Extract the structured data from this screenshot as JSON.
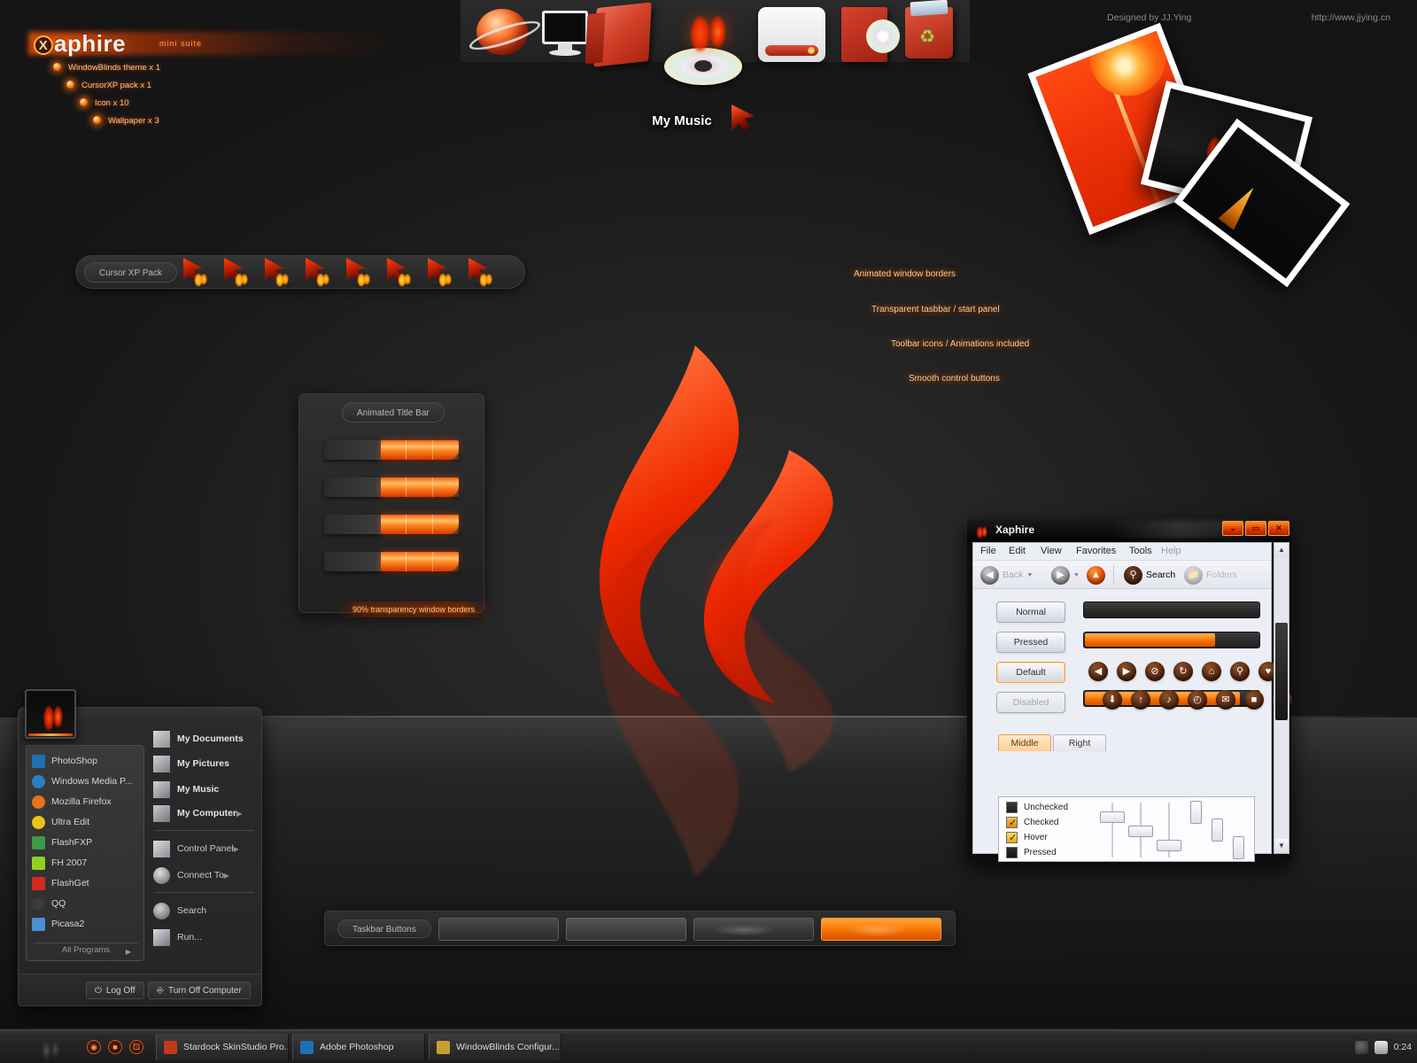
{
  "brand": {
    "name_x": "X",
    "name": "aphire",
    "subtitle": "mini suite",
    "items": [
      {
        "label": "WindowBlinds theme x 1"
      },
      {
        "label": "CursorXP pack x 1"
      },
      {
        "label": "Icon x 10"
      },
      {
        "label": "Wallpaper x 3"
      }
    ]
  },
  "credits": {
    "designer": "Designed by JJ.Ying",
    "url": "http://www.jjying.cn"
  },
  "desktop_icons": {
    "selected_label": "My Music",
    "icons": [
      {
        "name": "network-globe-icon"
      },
      {
        "name": "monitor-icon"
      },
      {
        "name": "folder-icon"
      },
      {
        "name": "cd-flame-icon"
      },
      {
        "name": "hard-drive-icon"
      },
      {
        "name": "cd-case-icon"
      },
      {
        "name": "recycle-bin-icon"
      }
    ]
  },
  "cursor_panel": {
    "label": "Cursor XP Pack",
    "count": 8
  },
  "titlebar_panel": {
    "label": "Animated Title Bar",
    "caption": "90% transparency window borders",
    "samples": 4
  },
  "callouts": [
    {
      "label": "Animated window borders"
    },
    {
      "label": "Transparent tasbbar / start panel"
    },
    {
      "label": "Toolbar icons / Animations included"
    },
    {
      "label": "Smooth control buttons"
    }
  ],
  "taskbar_buttons_panel": {
    "label": "Taskbar Buttons",
    "states": [
      "normal",
      "hover",
      "flare",
      "active"
    ]
  },
  "xaphire_window": {
    "title": "Xaphire",
    "window_controls": [
      {
        "name": "minimize-button",
        "glyph": "⌄"
      },
      {
        "name": "maximize-button",
        "glyph": "▭"
      },
      {
        "name": "close-button",
        "glyph": "✕"
      }
    ],
    "menu": [
      {
        "label": "File",
        "mnemonic": "F",
        "rest": "ile",
        "dim": false
      },
      {
        "label": "Edit",
        "mnemonic": "E",
        "rest": "dit",
        "dim": false
      },
      {
        "label": "View",
        "mnemonic": "V",
        "rest": "iew",
        "dim": false
      },
      {
        "label": "Favorites",
        "mnemonic": "F",
        "rest": "avorites",
        "dim": false
      },
      {
        "label": "Tools",
        "mnemonic": "T",
        "rest": "ools",
        "dim": false
      },
      {
        "label": "Help",
        "mnemonic": "H",
        "rest": "elp",
        "dim": true
      }
    ],
    "toolbar": {
      "back": "Back",
      "forward": "",
      "up": "",
      "search": "Search",
      "folders": "Folders"
    },
    "state_buttons": [
      {
        "label": "Normal",
        "state": "normal"
      },
      {
        "label": "Pressed",
        "state": "pressed"
      },
      {
        "label": "Default",
        "state": "default"
      },
      {
        "label": "Disabled",
        "state": "disabled"
      }
    ],
    "progress_bars": [
      {
        "name": "empty-progress",
        "percent": 0
      },
      {
        "name": "filled-progress",
        "percent": 74
      },
      {
        "name": "nearly-full-progress",
        "percent": 88
      }
    ],
    "toolbar_icon_glyphs_row1": [
      "◀",
      "▶",
      "⊘",
      "↻",
      "⌂",
      "⚲",
      "♥"
    ],
    "toolbar_icon_glyphs_row2": [
      "⬇",
      "↑",
      "♪",
      "◴",
      "✉",
      "■",
      "▬"
    ],
    "tabs": [
      {
        "label": "Middle",
        "active": true
      },
      {
        "label": "Right",
        "active": false
      }
    ],
    "checkbox_states": [
      {
        "label": "Unchecked",
        "state": "unchecked"
      },
      {
        "label": "Checked",
        "state": "checked"
      },
      {
        "label": "Hover",
        "state": "hover"
      },
      {
        "label": "Pressed",
        "state": "pressed"
      }
    ]
  },
  "start_menu": {
    "programs": [
      {
        "label": "PhotoShop",
        "color": "#1f6fb5"
      },
      {
        "label": "Windows Media P...",
        "color": "#2a7fc0"
      },
      {
        "label": "Mozilla Firefox",
        "color": "#e8731a"
      },
      {
        "label": "Ultra Edit",
        "color": "#e8c418"
      },
      {
        "label": "FlashFXP",
        "color": "#3c9a4a"
      },
      {
        "label": "FH 2007",
        "color": "#8fd020"
      },
      {
        "label": "FlashGet",
        "color": "#d42a1e"
      },
      {
        "label": "QQ",
        "color": "#3a3a3a"
      },
      {
        "label": "Picasa2",
        "color": "#4b8fd0"
      }
    ],
    "all_programs": "All Programs",
    "places": [
      {
        "label": "My Documents",
        "bold": true,
        "arrow": false,
        "icon": "documents-icon"
      },
      {
        "label": "My Pictures",
        "bold": true,
        "arrow": false,
        "icon": "pictures-icon"
      },
      {
        "label": "My Music",
        "bold": true,
        "arrow": false,
        "icon": "music-icon"
      },
      {
        "label": "My Computer",
        "bold": true,
        "arrow": true,
        "icon": "computer-icon"
      },
      {
        "label": "Control Panel",
        "bold": false,
        "arrow": true,
        "icon": "control-panel-icon"
      },
      {
        "label": "Connect To",
        "bold": false,
        "arrow": true,
        "icon": "connect-to-icon"
      },
      {
        "label": "Search",
        "bold": false,
        "arrow": false,
        "icon": "search-icon"
      },
      {
        "label": "Run...",
        "bold": false,
        "arrow": false,
        "icon": "run-icon"
      }
    ],
    "log_off": "Log Off",
    "turn_off": "Turn Off Computer"
  },
  "taskbar": {
    "quick_launch": [
      "quicklaunch-icon-1",
      "quicklaunch-icon-2",
      "quicklaunch-icon-3"
    ],
    "windows": [
      {
        "label": "Stardock SkinStudio Pro...",
        "color": "#c03a1a"
      },
      {
        "label": "Adobe Photoshop",
        "color": "#1f6fb5"
      },
      {
        "label": "WindowBlinds Configur...",
        "color": "#c8a030"
      }
    ],
    "clock": "0:24",
    "tray_icons": [
      "network-tray-icon",
      "shield-tray-icon"
    ]
  },
  "colors": {
    "accent": "#ff7a10",
    "accent_deep": "#d63400",
    "desktop": "#222222",
    "panel": "#2d2d2d",
    "window_client": "#eceef5"
  }
}
